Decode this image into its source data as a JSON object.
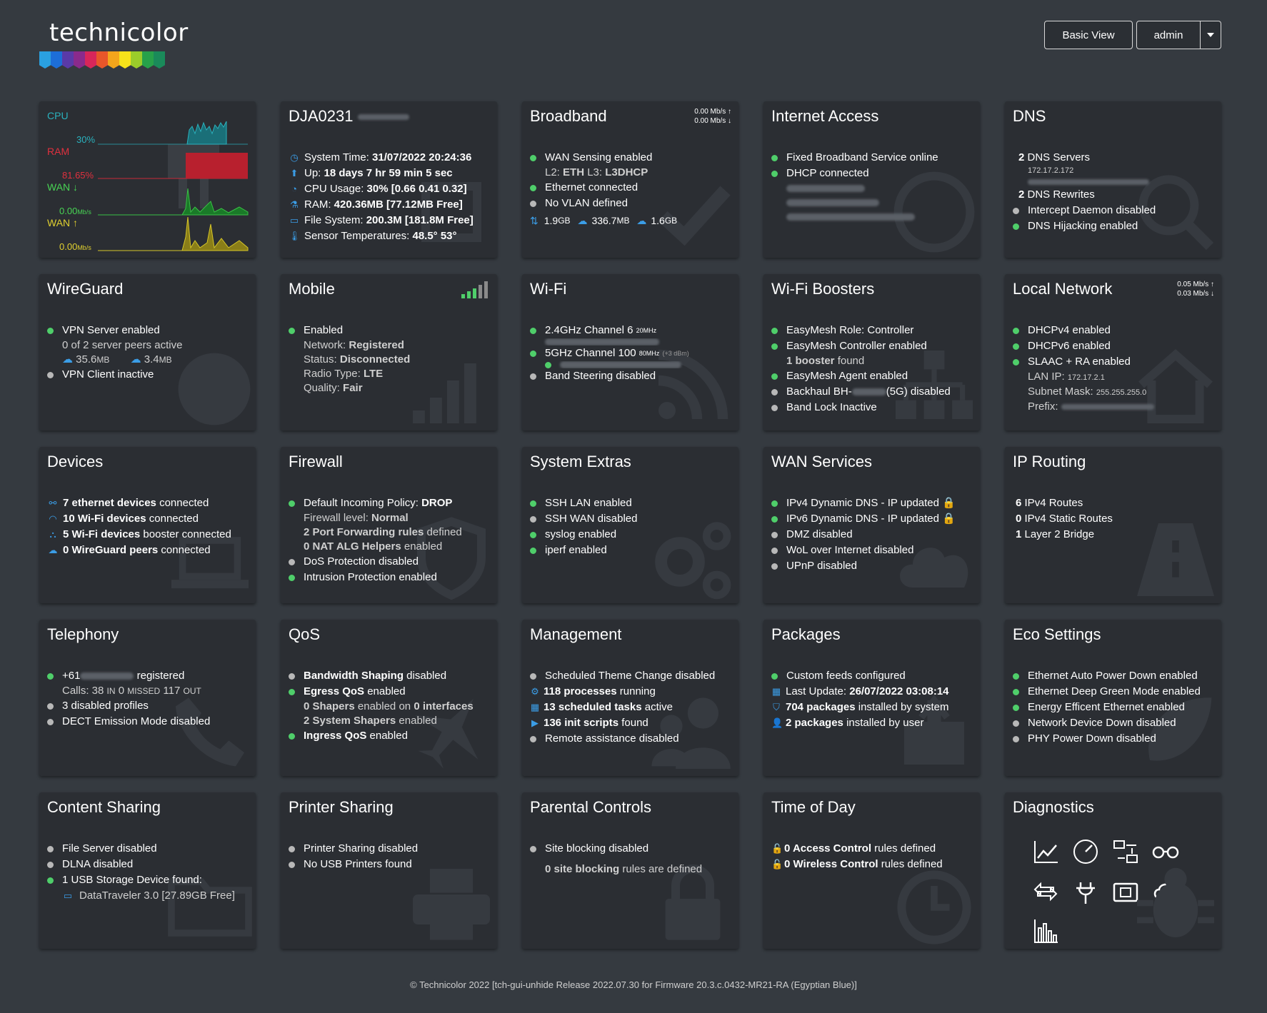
{
  "brand": {
    "name": "technicolor",
    "colors": [
      "#2aa0e0",
      "#1d6ed8",
      "#5a3aa8",
      "#8a2a8c",
      "#d8265a",
      "#e8562a",
      "#f3a51c",
      "#f6e21a",
      "#9bcc2a",
      "#27a14a",
      "#1a8a5a"
    ]
  },
  "header": {
    "basic_view": "Basic View",
    "user": "admin"
  },
  "cards": {
    "gateway": {
      "cpu": "CPU",
      "cpu_val": "30%",
      "ram": "RAM",
      "ram_val": "81.65%",
      "wan_down": "WAN ↓",
      "wan_down_val": "0.00",
      "wan_up": "WAN ↑",
      "wan_up_val": "0.00",
      "unit": "Mb/s"
    },
    "device": {
      "title": "DJA0231",
      "time_label": "System Time:",
      "time": "31/07/2022 20:24:36",
      "up_label": "Up:",
      "up": "18 days 7 hr 59 min 5 sec",
      "cpu_label": "CPU Usage:",
      "cpu": "30% [0.66 0.41 0.32]",
      "ram_label": "RAM:",
      "ram": "420.36MB [77.12MB Free]",
      "fs_label": "File System:",
      "fs": "200.3M [181.8M Free]",
      "temp_label": "Sensor Temperatures:",
      "temp": "48.5° 53°"
    },
    "broadband": {
      "title": "Broadband",
      "rate_up": "0.00 Mb/s",
      "rate_down": "0.00 Mb/s",
      "l1": "WAN Sensing enabled",
      "l2a": "L2:",
      "l2b": "ETH",
      "l2c": "L3:",
      "l2d": "L3DHCP",
      "l3": "Ethernet connected",
      "l4": "No VLAN defined",
      "s1": "1.9",
      "s1u": "GB",
      "s2": "336.7",
      "s2u": "MB",
      "s3": "1.6",
      "s3u": "GB"
    },
    "internet": {
      "title": "Internet Access",
      "l1": "Fixed Broadband Service online",
      "l2": "DHCP connected"
    },
    "dns": {
      "title": "DNS",
      "l1a": "2",
      "l1b": "DNS Servers",
      "ip": "172.17.2.172",
      "l2a": "2",
      "l2b": "DNS Rewrites",
      "l3": "Intercept Daemon disabled",
      "l4": "DNS Hijacking enabled"
    },
    "wireguard": {
      "title": "WireGuard",
      "l1": "VPN Server enabled",
      "l2": "0 of 2 server peers active",
      "d1": "35.6",
      "d1u": "MB",
      "d2": "3.4",
      "d2u": "MB",
      "l3": "VPN Client inactive"
    },
    "mobile": {
      "title": "Mobile",
      "l1": "Enabled",
      "net_l": "Network:",
      "net": "Registered",
      "st_l": "Status:",
      "st": "Disconnected",
      "rt_l": "Radio Type:",
      "rt": "LTE",
      "q_l": "Quality:",
      "q": "Fair"
    },
    "wifi": {
      "title": "Wi-Fi",
      "l1": "2.4GHz Channel 6",
      "l1s": "20MHz",
      "l2": "5GHz Channel 100",
      "l2s": "80MHz",
      "l2t": "(+3 dBm)",
      "l3": "Band Steering disabled"
    },
    "boosters": {
      "title": "Wi-Fi Boosters",
      "l1": "EasyMesh Role: Controller",
      "l2": "EasyMesh Controller enabled",
      "l3a": "1 booster",
      "l3b": "found",
      "l4": "EasyMesh Agent enabled",
      "l5a": "Backhaul BH-",
      "l5b": "(5G) disabled",
      "l6": "Band Lock Inactive"
    },
    "lan": {
      "title": "Local Network",
      "rate_up": "0.05 Mb/s",
      "rate_down": "0.03 Mb/s",
      "l1": "DHCPv4 enabled",
      "l2": "DHCPv6 enabled",
      "l3": "SLAAC + RA enabled",
      "ip_l": "LAN IP:",
      "ip": "172.17.2.1",
      "mask_l": "Subnet Mask:",
      "mask": "255.255.255.0",
      "pref_l": "Prefix:"
    },
    "devices": {
      "title": "Devices",
      "l1a": "7 ethernet devices",
      "l1b": "connected",
      "l2a": "10 Wi-Fi devices",
      "l2b": "connected",
      "l3a": "5 Wi-Fi devices",
      "l3b": "booster connected",
      "l4a": "0 WireGuard peers",
      "l4b": "connected"
    },
    "firewall": {
      "title": "Firewall",
      "l1a": "Default Incoming Policy:",
      "l1b": "DROP",
      "s1a": "Firewall level:",
      "s1b": "Normal",
      "s2a": "2 Port Forwarding rules",
      "s2b": "defined",
      "s3a": "0 NAT ALG Helpers",
      "s3b": "enabled",
      "l2": "DoS Protection disabled",
      "l3": "Intrusion Protection enabled"
    },
    "extras": {
      "title": "System Extras",
      "l1": "SSH LAN enabled",
      "l2": "SSH WAN disabled",
      "l3": "syslog enabled",
      "l4": "iperf enabled"
    },
    "wan": {
      "title": "WAN Services",
      "l1": "IPv4 Dynamic DNS - IP updated",
      "l2": "IPv6 Dynamic DNS - IP updated",
      "l3": "DMZ disabled",
      "l4": "WoL over Internet disabled",
      "l5": "UPnP disabled"
    },
    "routing": {
      "title": "IP Routing",
      "l1a": "6",
      "l1b": "IPv4 Routes",
      "l2a": "0",
      "l2b": "IPv4 Static Routes",
      "l3a": "1",
      "l3b": "Layer 2 Bridge"
    },
    "telephony": {
      "title": "Telephony",
      "l1a": "+61",
      "l1b": "registered",
      "calls": "Calls: 38",
      "in": "IN",
      "missed_n": "0",
      "missed": "MISSED",
      "out_n": "117",
      "out": "OUT",
      "l2": "3 disabled profiles",
      "l3": "DECT Emission Mode disabled"
    },
    "qos": {
      "title": "QoS",
      "l1a": "Bandwidth Shaping",
      "l1b": "disabled",
      "l2a": "Egress QoS",
      "l2b": "enabled",
      "s1a": "0 Shapers",
      "s1b": "enabled on",
      "s1c": "0 interfaces",
      "s2a": "2 System Shapers",
      "s2b": "enabled",
      "l3a": "Ingress QoS",
      "l3b": "enabled"
    },
    "mgmt": {
      "title": "Management",
      "l1": "Scheduled Theme Change disabled",
      "l2a": "118 processes",
      "l2b": "running",
      "l3a": "13 scheduled tasks",
      "l3b": "active",
      "l4a": "136 init scripts",
      "l4b": "found",
      "l5": "Remote assistance disabled"
    },
    "packages": {
      "title": "Packages",
      "l1": "Custom feeds configured",
      "l2a": "Last Update:",
      "l2b": "26/07/2022 03:08:14",
      "l3a": "704 packages",
      "l3b": "installed by system",
      "l4a": "2 packages",
      "l4b": "installed by user"
    },
    "eco": {
      "title": "Eco Settings",
      "l1": "Ethernet Auto Power Down enabled",
      "l2": "Ethernet Deep Green Mode enabled",
      "l3": "Energy Efficent Ethernet enabled",
      "l4": "Network Device Down disabled",
      "l5": "PHY Power Down disabled"
    },
    "content": {
      "title": "Content Sharing",
      "l1": "File Server disabled",
      "l2": "DLNA disabled",
      "l3": "1 USB Storage Device found:",
      "l4": "DataTraveler 3.0 [27.89GB Free]"
    },
    "printer": {
      "title": "Printer Sharing",
      "l1": "Printer Sharing disabled",
      "l2": "No USB Printers found"
    },
    "parental": {
      "title": "Parental Controls",
      "l1": "Site blocking disabled",
      "l2a": "0 site blocking",
      "l2b": "rules are defined"
    },
    "tod": {
      "title": "Time of Day",
      "l1a": "0 Access Control",
      "l1b": "rules defined",
      "l2a": "0 Wireless Control",
      "l2b": "rules defined"
    },
    "diag": {
      "title": "Diagnostics"
    }
  },
  "footer": "© Technicolor 2022 [tch-gui-unhide Release 2022.07.30 for Firmware 20.3.c.0432-MR21-RA (Egyptian Blue)]"
}
